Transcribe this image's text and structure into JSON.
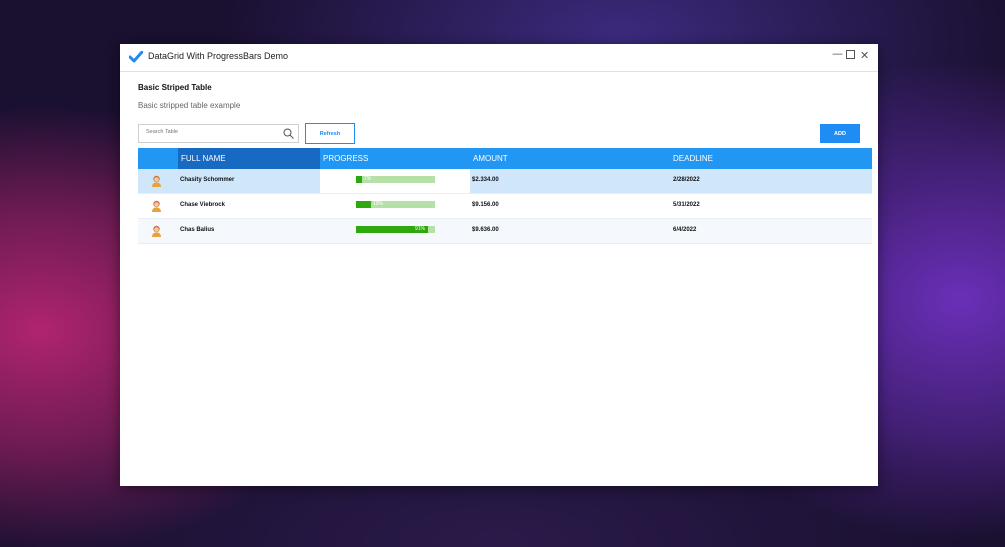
{
  "window": {
    "title": "DataGrid With ProgressBars Demo",
    "controls": {
      "minimize": "—",
      "close": "✕"
    }
  },
  "page": {
    "heading": "Basic Striped Table",
    "subheading": "Basic stripped table example"
  },
  "toolbar": {
    "search_placeholder": "Search Table",
    "refresh_label": "Refresh",
    "add_label": "ADD"
  },
  "grid": {
    "columns": [
      "",
      "FULL NAME",
      "PROGRESS",
      "AMOUNT",
      "DEADLINE"
    ],
    "rows": [
      {
        "name": "Chasity Schommer",
        "progress": 0.07,
        "progress_label": "7%",
        "amount": "$2.334.00",
        "deadline": "2/28/2022"
      },
      {
        "name": "Chase Viebrock",
        "progress": 0.19,
        "progress_label": "19%",
        "amount": "$9.156.00",
        "deadline": "5/31/2022"
      },
      {
        "name": "Chas Balius",
        "progress": 0.91,
        "progress_label": "91%",
        "amount": "$9.636.00",
        "deadline": "6/4/2022"
      }
    ]
  },
  "colors": {
    "accent": "#1e8cf3",
    "header": "#2196f3",
    "sorted_header": "#1769c2",
    "progress_fill": "#2ea80e",
    "progress_track": "#b5e0a6",
    "selected_row": "#cfe6fb"
  },
  "icons": {
    "app": "checkmark-icon",
    "search": "search-icon",
    "avatar": "user-avatar-icon"
  }
}
